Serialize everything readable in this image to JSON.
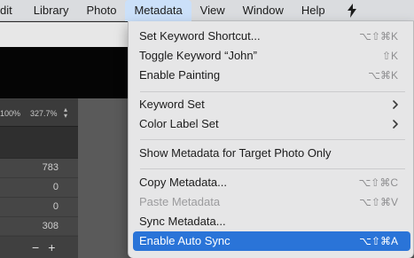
{
  "menubar": {
    "items": [
      {
        "label": "dit"
      },
      {
        "label": "Library"
      },
      {
        "label": "Photo"
      },
      {
        "label": "Metadata"
      },
      {
        "label": "View"
      },
      {
        "label": "Window"
      },
      {
        "label": "Help"
      }
    ],
    "active_item": "Metadata",
    "app_icon": "lightroom-helper-icon"
  },
  "background": {
    "zoom_values": [
      "100%",
      "327.7%"
    ],
    "stats": [
      "783",
      "0",
      "0",
      "308"
    ],
    "controls": {
      "minus": "−",
      "plus": "+"
    }
  },
  "dropdown": {
    "items": [
      {
        "label": "Set Keyword Shortcut...",
        "shortcut": "⌥⇧⌘K"
      },
      {
        "label": "Toggle Keyword “John”",
        "shortcut": "⇧K"
      },
      {
        "label": "Enable Painting",
        "shortcut": "⌥⌘K"
      },
      {
        "label": "Keyword Set",
        "submenu": true
      },
      {
        "label": "Color Label Set",
        "submenu": true
      },
      {
        "label": "Show Metadata for Target Photo Only"
      },
      {
        "label": "Copy Metadata...",
        "shortcut": "⌥⇧⌘C"
      },
      {
        "label": "Paste Metadata",
        "shortcut": "⌥⇧⌘V",
        "disabled": true
      },
      {
        "label": "Sync Metadata..."
      },
      {
        "label": "Enable Auto Sync",
        "shortcut": "⌥⇧⌘A",
        "highlighted": true
      }
    ],
    "colors": {
      "highlight": "#2a74d8",
      "menu_bg": "#e6e6e7",
      "shortcut": "#8e8e90"
    }
  }
}
